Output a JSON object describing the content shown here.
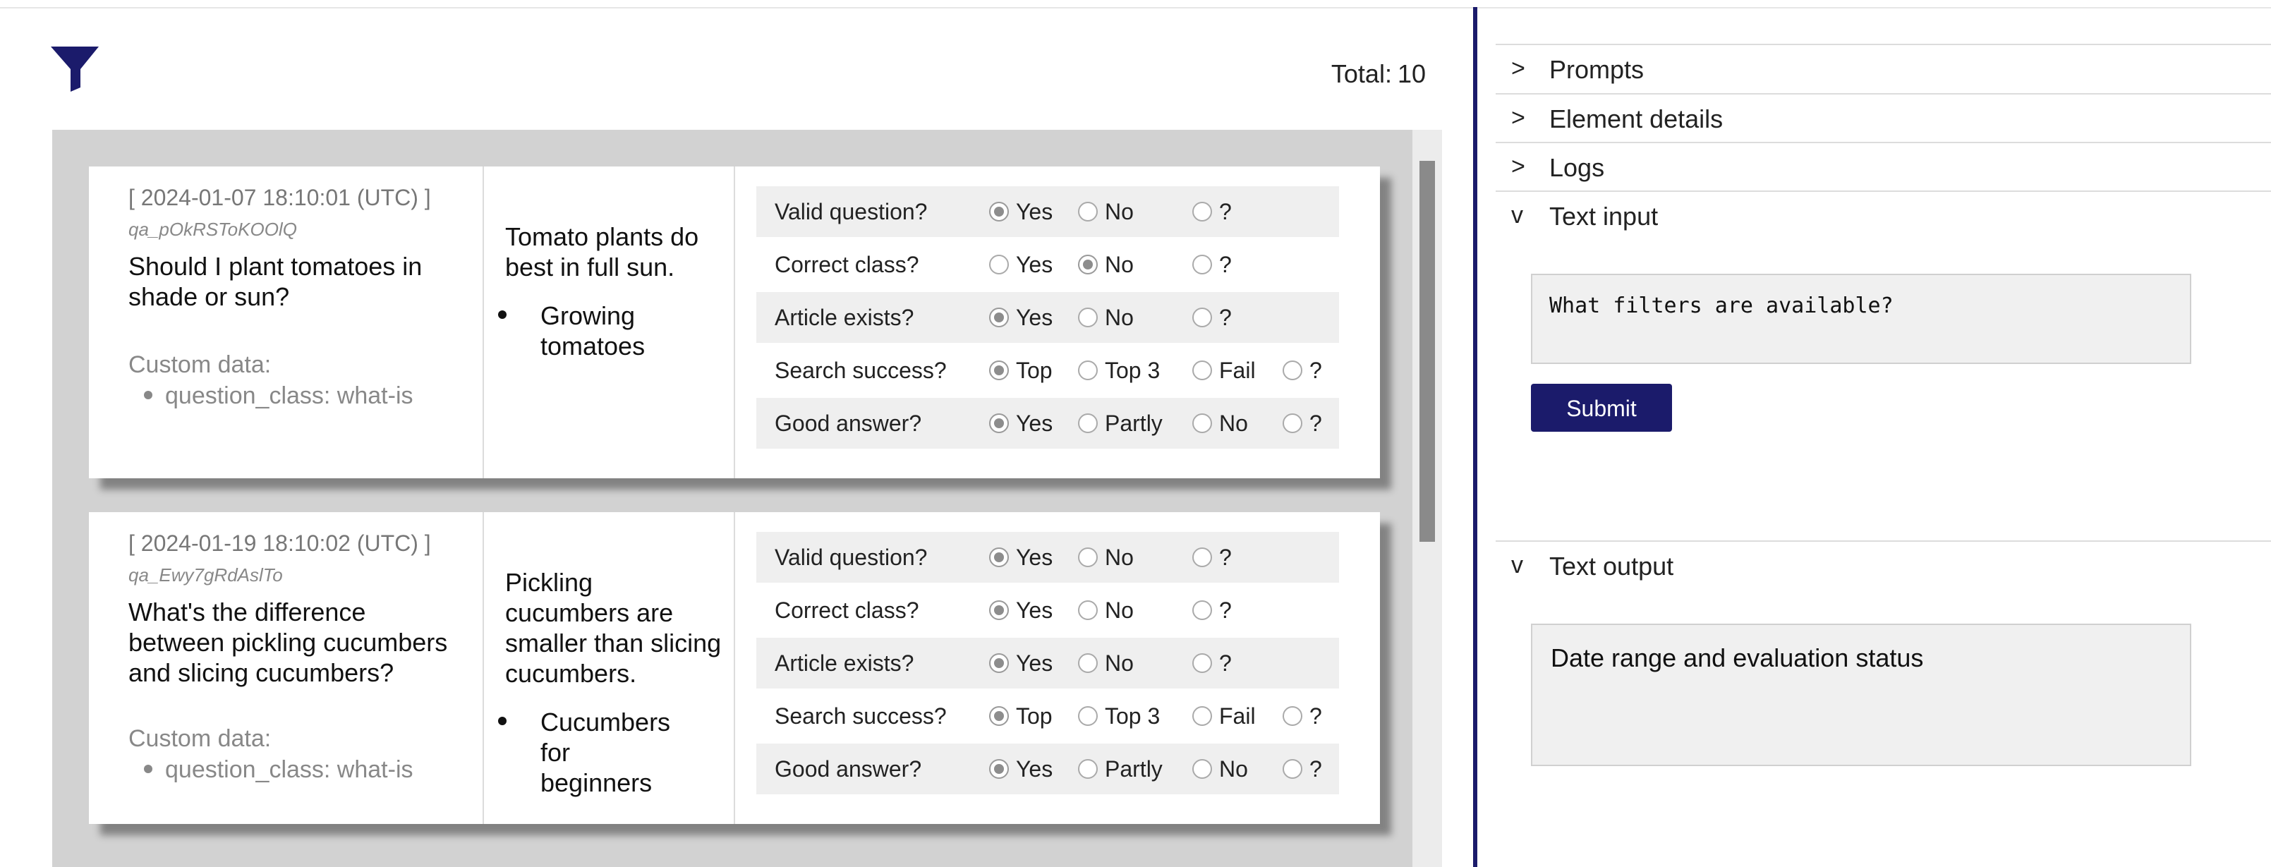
{
  "header": {
    "filter_icon": "filter-funnel-icon",
    "total_label": "Total:",
    "total_value": "10"
  },
  "entries": [
    {
      "timestamp": "[ 2024-01-07 18:10:01 (UTC) ]",
      "qid": "qa_pOkRSToKOOlQ",
      "question": "Should I plant tomatoes in shade or sun?",
      "custom_title": "Custom data:",
      "custom_item": "question_class: what-is",
      "answer": "Tomato plants do best in full sun.",
      "article": "Growing tomatoes",
      "evals": [
        {
          "label": "Valid question?",
          "options": [
            "Yes",
            "No",
            "?"
          ],
          "selected": "Yes"
        },
        {
          "label": "Correct class?",
          "options": [
            "Yes",
            "No",
            "?"
          ],
          "selected": "No"
        },
        {
          "label": "Article exists?",
          "options": [
            "Yes",
            "No",
            "?"
          ],
          "selected": "Yes"
        },
        {
          "label": "Search success?",
          "options": [
            "Top",
            "Top 3",
            "Fail",
            "?"
          ],
          "selected": "Top"
        },
        {
          "label": "Good answer?",
          "options": [
            "Yes",
            "Partly",
            "No",
            "?"
          ],
          "selected": "Yes"
        }
      ]
    },
    {
      "timestamp": "[ 2024-01-19 18:10:02 (UTC) ]",
      "qid": "qa_Ewy7gRdAslTo",
      "question": "What's the difference between pickling cucumbers and slicing cucumbers?",
      "custom_title": "Custom data:",
      "custom_item": "question_class: what-is",
      "answer": "Pickling cucumbers are smaller than slicing cucumbers.",
      "article": "Cucumbers for beginners",
      "evals": [
        {
          "label": "Valid question?",
          "options": [
            "Yes",
            "No",
            "?"
          ],
          "selected": "Yes"
        },
        {
          "label": "Correct class?",
          "options": [
            "Yes",
            "No",
            "?"
          ],
          "selected": "Yes"
        },
        {
          "label": "Article exists?",
          "options": [
            "Yes",
            "No",
            "?"
          ],
          "selected": "Yes"
        },
        {
          "label": "Search success?",
          "options": [
            "Top",
            "Top 3",
            "Fail",
            "?"
          ],
          "selected": "Top"
        },
        {
          "label": "Good answer?",
          "options": [
            "Yes",
            "Partly",
            "No",
            "?"
          ],
          "selected": "Yes"
        }
      ]
    }
  ],
  "sidebar": {
    "sections": [
      {
        "chevron": ">",
        "title": "Prompts"
      },
      {
        "chevron": ">",
        "title": "Element details"
      },
      {
        "chevron": ">",
        "title": "Logs"
      },
      {
        "chevron": "v",
        "title": "Text input"
      },
      {
        "chevron": "v",
        "title": "Text output"
      }
    ],
    "text_input_value": "What filters are available?",
    "submit_label": "Submit",
    "text_output_value": "Date range and evaluation status"
  },
  "colors": {
    "accent": "#1b1b6b",
    "list_background": "#d2d2d2",
    "row_shade": "#efefef"
  }
}
